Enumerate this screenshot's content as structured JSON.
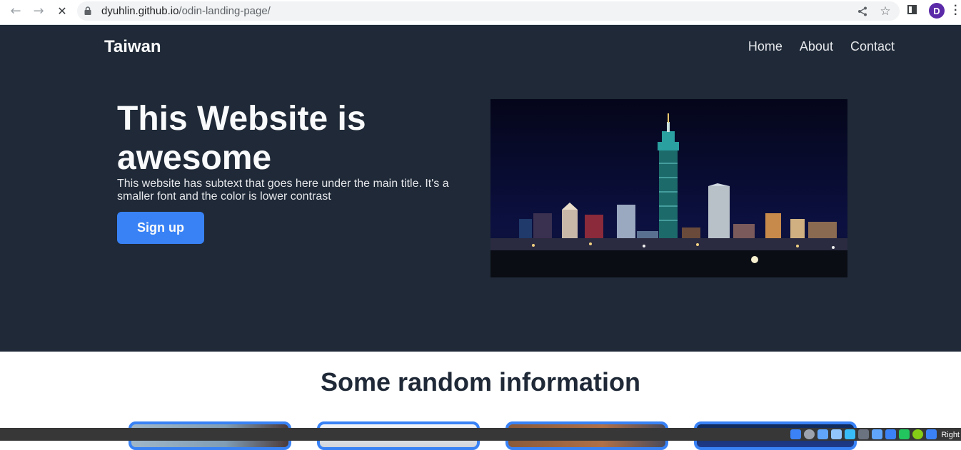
{
  "browser": {
    "url_host": "dyuhlin.github.io",
    "url_path": "/odin-landing-page/",
    "avatar_letter": "D",
    "icons": [
      "back-arrow-icon",
      "forward-arrow-icon",
      "stop-loading-icon",
      "lock-icon",
      "share-icon",
      "star-icon",
      "side-panel-icon",
      "more-menu-icon"
    ]
  },
  "site": {
    "brand": "Taiwan",
    "nav": [
      "Home",
      "About",
      "Contact"
    ]
  },
  "hero": {
    "title": "This Website is awesome",
    "subtitle": "This website has subtext that goes here under the main title. It's a smaller font and the color is lower contrast",
    "cta": "Sign up"
  },
  "info": {
    "title": "Some random information"
  },
  "taskbar": {
    "label": "Right"
  },
  "colors": {
    "hero_bg": "#1f2937",
    "accent": "#3882f6",
    "text_light": "#f9fafb",
    "text_muted": "#e5e7eb",
    "heading_dark": "#1f2937"
  }
}
